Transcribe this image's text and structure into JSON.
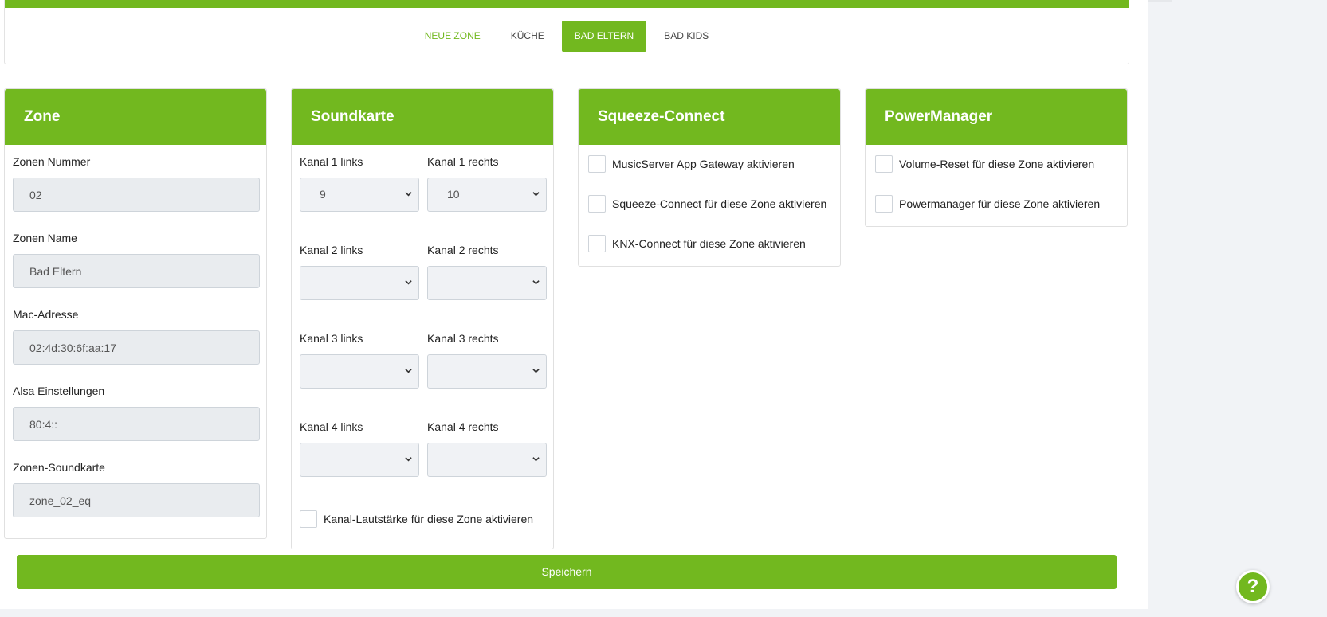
{
  "tabs": [
    {
      "label": "NEUE ZONE"
    },
    {
      "label": "KÜCHE"
    },
    {
      "label": "BAD ELTERN"
    },
    {
      "label": "BAD KIDS"
    }
  ],
  "zone": {
    "title": "Zone",
    "fields": [
      {
        "label": "Zonen Nummer",
        "value": "02"
      },
      {
        "label": "Zonen Name",
        "value": "Bad Eltern"
      },
      {
        "label": "Mac-Adresse",
        "value": "02:4d:30:6f:aa:17"
      },
      {
        "label": "Alsa Einstellungen",
        "value": "80:4::"
      },
      {
        "label": "Zonen-Soundkarte",
        "value": "zone_02_eq"
      }
    ]
  },
  "soundkarte": {
    "title": "Soundkarte",
    "rows": [
      {
        "left_label": "Kanal 1 links",
        "left_value": "9",
        "right_label": "Kanal 1 rechts",
        "right_value": "10"
      },
      {
        "left_label": "Kanal 2 links",
        "left_value": "",
        "right_label": "Kanal 2 rechts",
        "right_value": ""
      },
      {
        "left_label": "Kanal 3 links",
        "left_value": "",
        "right_label": "Kanal 3 rechts",
        "right_value": ""
      },
      {
        "left_label": "Kanal 4 links",
        "left_value": "",
        "right_label": "Kanal 4 rechts",
        "right_value": ""
      }
    ],
    "volume_checkbox": "Kanal-Lautstärke für diese Zone aktivieren"
  },
  "squeeze": {
    "title": "Squeeze-Connect",
    "checks": [
      {
        "label": "MusicServer App Gateway aktivieren"
      },
      {
        "label": "Squeeze-Connect für diese Zone aktivieren"
      },
      {
        "label": "KNX-Connect für diese Zone aktivieren"
      }
    ]
  },
  "power": {
    "title": "PowerManager",
    "checks": [
      {
        "label": "Volume-Reset für diese Zone aktivieren"
      },
      {
        "label": "Powermanager für diese Zone aktivieren"
      }
    ]
  },
  "save_label": "Speichern",
  "help_label": "?",
  "colors": {
    "accent": "#72b81f"
  }
}
